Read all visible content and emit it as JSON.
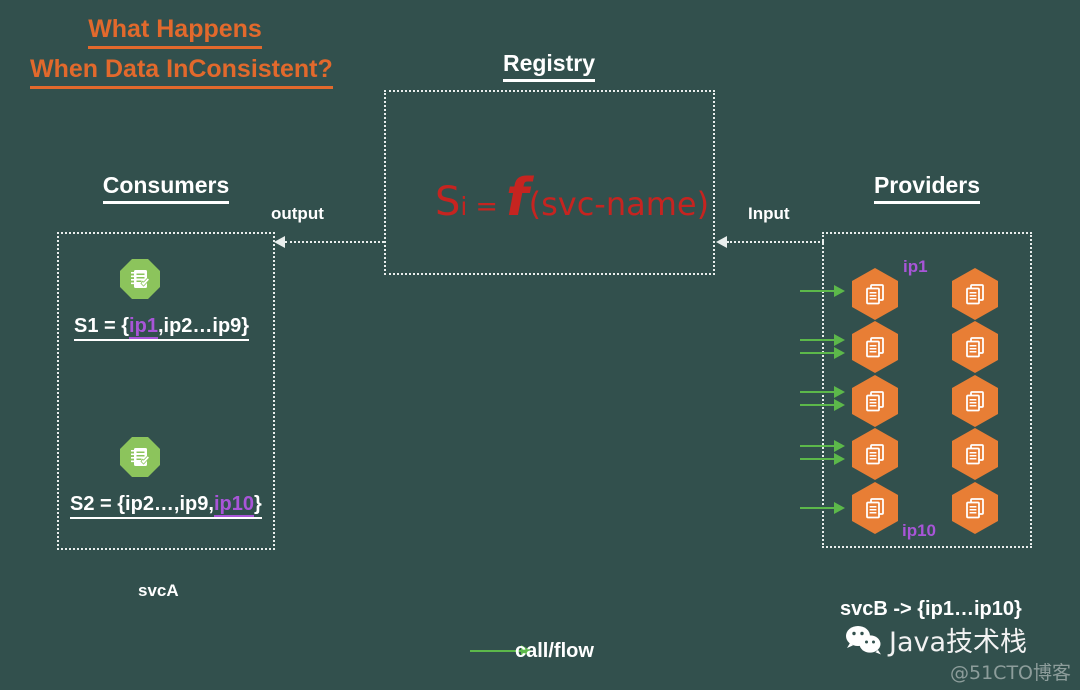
{
  "title": {
    "line1": "What Happens",
    "line2": "When Data InConsistent?",
    "color": "#e2692c"
  },
  "background_color": "#32504d",
  "registry": {
    "heading": "Registry",
    "formula": {
      "s": "S",
      "i": "i",
      "equals": "=",
      "f": "f",
      "arg": "(svc-name)",
      "color": "#c62420"
    }
  },
  "consumers": {
    "heading": "Consumers",
    "icon": "notepad-check-icon",
    "entries": [
      {
        "prefix": "S1 = {",
        "highlight": "ip1",
        "suffix": ",ip2…ip9}"
      },
      {
        "prefix": "S2 = {ip2…,ip9,",
        "highlight": "ip10",
        "suffix": "}"
      }
    ],
    "service_label": "svcA",
    "highlight_color": "#a855d8"
  },
  "providers": {
    "heading": "Providers",
    "icon": "documents-stack-icon",
    "top_label": "ip1",
    "bottom_label": "ip10",
    "mapping_label": "svcB -> {ip1…ip10}",
    "node_count": 10,
    "columns": 2,
    "rows": 5,
    "arrow_count": 7,
    "hex_color": "#e87e35"
  },
  "flows": {
    "output_label": "output",
    "input_label": "Input",
    "arrow_direction": "left",
    "line_color": "#e9eeed"
  },
  "legend": {
    "label": "call/flow",
    "arrow_color": "#5cb84a"
  },
  "watermark": {
    "wechat_name": "Java技术栈",
    "attribution": "@51CTO博客",
    "logo": "wechat-icon"
  }
}
